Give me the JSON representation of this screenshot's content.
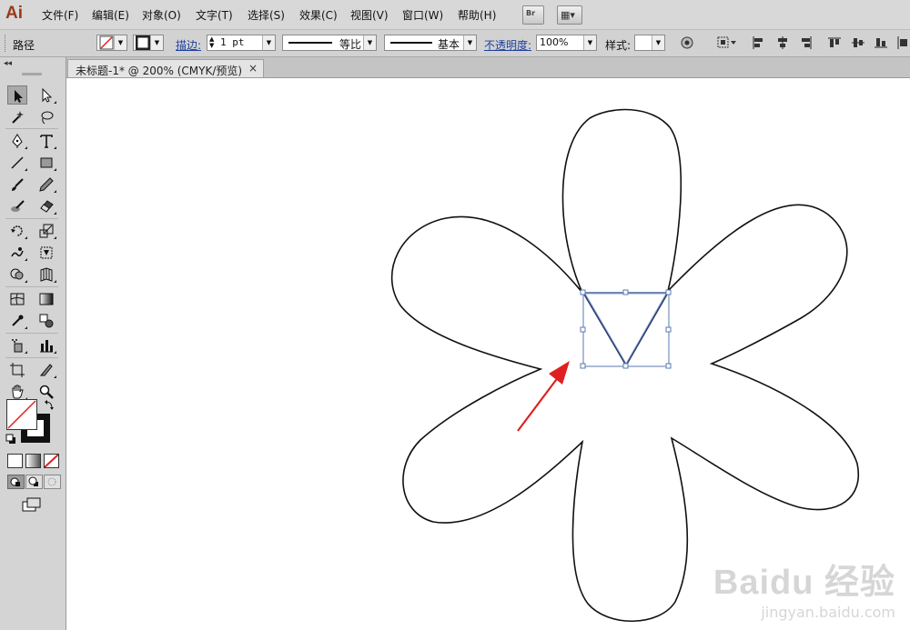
{
  "app": {
    "logo": "Ai"
  },
  "menu": [
    "文件(F)",
    "编辑(E)",
    "对象(O)",
    "文字(T)",
    "选择(S)",
    "效果(C)",
    "视图(V)",
    "窗口(W)",
    "帮助(H)"
  ],
  "menubar_buttons": {
    "bridge": "Br",
    "workspace": "▦▾"
  },
  "control_bar": {
    "selection_type": "路径",
    "stroke_label": "描边:",
    "stroke_weight": "1 pt",
    "profile_label": "等比",
    "brush_label": "基本",
    "opacity_label": "不透明度:",
    "opacity_value": "100%",
    "style_label": "样式:"
  },
  "document_tab": {
    "title": "未标题-1* @ 200% (CMYK/预览)",
    "close": "×"
  },
  "panel": {
    "collapse": "◂◂"
  },
  "watermark": {
    "logo": "Baidu 经验",
    "url": "jingyan.baidu.com"
  },
  "colors": {
    "stroke_path": "#111111",
    "selection": "#5a78b0",
    "arrow": "#e02020",
    "logo": "#9b3a1a"
  },
  "icons": [
    "selection-tool-icon",
    "direct-selection-tool-icon",
    "magic-wand-tool-icon",
    "lasso-tool-icon",
    "pen-tool-icon",
    "type-tool-icon",
    "line-tool-icon",
    "rectangle-tool-icon",
    "paintbrush-tool-icon",
    "pencil-tool-icon",
    "blob-brush-tool-icon",
    "eraser-tool-icon",
    "rotate-tool-icon",
    "scale-tool-icon",
    "warp-tool-icon",
    "free-transform-tool-icon",
    "shape-builder-tool-icon",
    "perspective-grid-tool-icon",
    "mesh-tool-icon",
    "gradient-tool-icon",
    "eyedropper-tool-icon",
    "blend-tool-icon",
    "symbol-sprayer-tool-icon",
    "column-graph-tool-icon",
    "artboard-tool-icon",
    "slice-tool-icon",
    "hand-tool-icon",
    "zoom-tool-icon",
    "swap-colors-icon",
    "default-colors-icon",
    "change-screen-mode-icon",
    "globe-icon",
    "align-icons"
  ]
}
